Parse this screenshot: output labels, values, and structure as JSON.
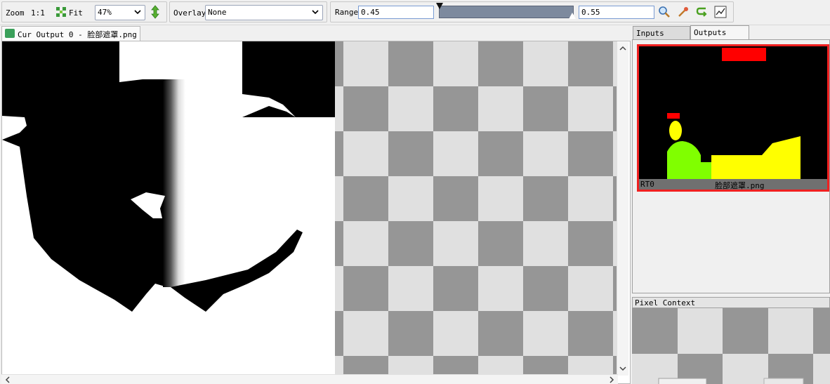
{
  "toolbar": {
    "zoom_label": "Zoom",
    "zoom_1to1": "1:1",
    "fit_label": "Fit",
    "zoom_value": "47%",
    "overlay_label": "Overlay",
    "overlay_value": "None",
    "range_label": "Range",
    "range_min": "0.45",
    "range_max": "0.55"
  },
  "document": {
    "tab_title": "Cur Output 0 - 脸部遮罩.png"
  },
  "right_panel": {
    "tabs": [
      {
        "label": "Inputs",
        "active": false
      },
      {
        "label": "Outputs",
        "active": true
      }
    ],
    "thumbnail": {
      "slot": "RT0",
      "filename": "脸部遮罩.png",
      "border_color": "#f02020"
    },
    "pixel_context_label": "Pixel Context"
  },
  "colors": {
    "checker_light": "#e0e0e0",
    "checker_dark": "#969696",
    "selection_red": "#ff0000",
    "mask_yellow": "#ffff00",
    "mask_green": "#80ff00"
  }
}
